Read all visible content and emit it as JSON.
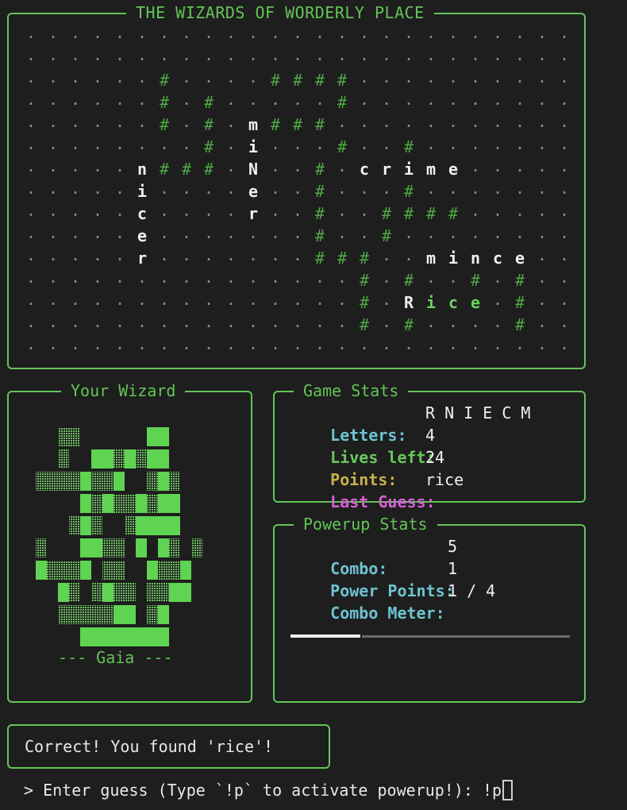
{
  "board": {
    "title": "THE WIZARDS OF WORDERLY PLACE",
    "grid": [
      ".........................",
      ".........................",
      "......#....####..........",
      "......#.#.....#..........",
      "......#.#.m###...........",
      "........#.i...#..#.......",
      ".....n###.N..#.crime.....",
      ".....i....e..#...#.......",
      ".....c....r..#..####.....",
      ".....e.......#..#........",
      ".....r.......###..mince..",
      "...............#.#..#.#..",
      "...............#.Rice.#..",
      "...............#.#....#..",
      "........................."
    ],
    "colors": {
      "dot": "#8a8a8a",
      "hash": "#4ea843",
      "letter": "#f0f0f0",
      "found": "#6bd35e"
    },
    "found_word": {
      "row": 12,
      "start": 18,
      "length": 4
    }
  },
  "wizard": {
    "title": "Your Wizard",
    "name": "--- Gaia ---",
    "art": [
      "   11      22   ",
      "   1  2212122   ",
      " 11112112  121  ",
      "     212112122  ",
      "    121  12222  ",
      " 1   2211 2 21 1",
      " 21112 11  2112 ",
      "   21 1211 1122 ",
      "   1111122 12   ",
      "     22222222   "
    ],
    "colors": {
      "light": "#6fbf63",
      "solid": "#5fd352"
    }
  },
  "game_stats": {
    "title": "Game Stats",
    "letters_label": "Letters:",
    "letters_value": "R N I E C M",
    "lives_label": "Lives left:",
    "lives_value": "4",
    "points_label": "Points:",
    "points_value": "24",
    "last_guess_label": "Last Guess:",
    "last_guess_value": "rice"
  },
  "powerup_stats": {
    "title": "Powerup Stats",
    "combo_label": "Combo:",
    "combo_value": "5",
    "power_points_label": "Power Points:",
    "power_points_value": "1",
    "combo_meter_label": "Combo Meter:",
    "combo_meter_value": "1 / 4",
    "combo_meter_fraction": 0.25
  },
  "message": {
    "text": "Correct! You found 'rice'!"
  },
  "prompt": {
    "text": "> Enter guess (Type `!p` to activate powerup!): ",
    "input_value": "!p"
  }
}
